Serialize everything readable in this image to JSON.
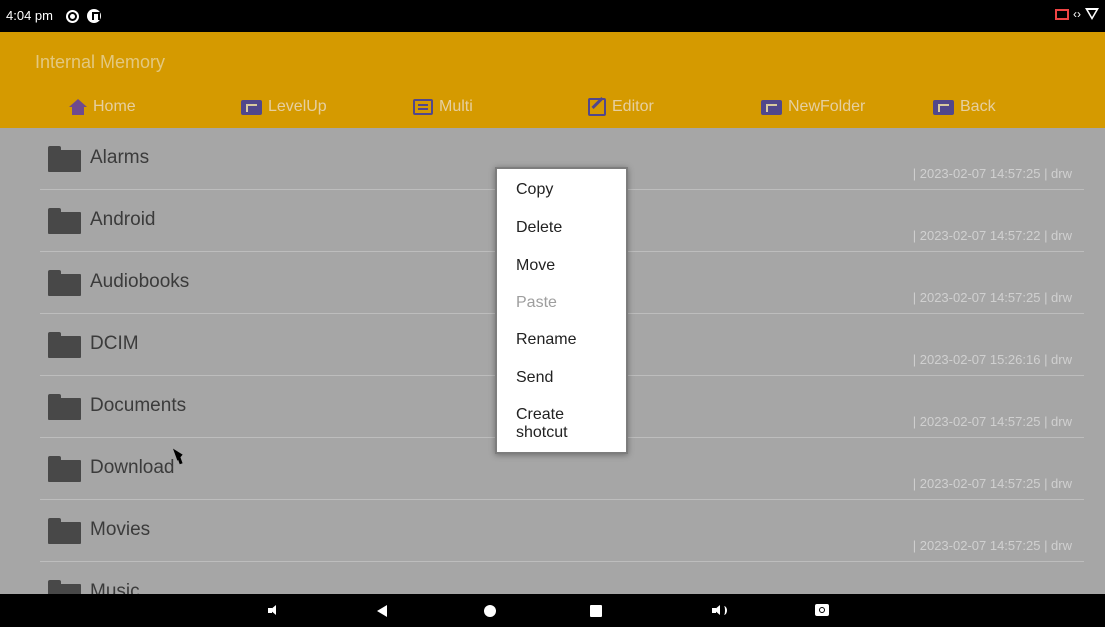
{
  "status_bar": {
    "time": "4:04 pm"
  },
  "app": {
    "title": "Internal Memory",
    "toolbar": [
      {
        "label": "Home",
        "icon": "home-icon"
      },
      {
        "label": "LevelUp",
        "icon": "folder-up-icon"
      },
      {
        "label": "Multi",
        "icon": "multi-select-icon"
      },
      {
        "label": "Editor",
        "icon": "edit-icon"
      },
      {
        "label": "NewFolder",
        "icon": "new-folder-icon"
      },
      {
        "label": "Back",
        "icon": "back-folder-icon"
      }
    ]
  },
  "files": [
    {
      "name": "Alarms",
      "meta": "| 2023-02-07 14:57:25 | drw"
    },
    {
      "name": "Android",
      "meta": "| 2023-02-07 14:57:22 | drw"
    },
    {
      "name": "Audiobooks",
      "meta": "| 2023-02-07 14:57:25 | drw"
    },
    {
      "name": "DCIM",
      "meta": "| 2023-02-07 15:26:16 | drw"
    },
    {
      "name": "Documents",
      "meta": "| 2023-02-07 14:57:25 | drw"
    },
    {
      "name": "Download",
      "meta": "| 2023-02-07 14:57:25 | drw"
    },
    {
      "name": "Movies",
      "meta": "| 2023-02-07 14:57:25 | drw"
    },
    {
      "name": "Music",
      "meta": ""
    }
  ],
  "context_menu": {
    "items": [
      {
        "label": "Copy",
        "enabled": true
      },
      {
        "label": "Delete",
        "enabled": true
      },
      {
        "label": "Move",
        "enabled": true
      },
      {
        "label": "Paste",
        "enabled": false
      },
      {
        "label": "Rename",
        "enabled": true
      },
      {
        "label": "Send",
        "enabled": true
      },
      {
        "label": "Create shotcut",
        "enabled": true
      }
    ]
  },
  "colors": {
    "header": "#d59a00",
    "list_background": "#a6a6a6",
    "toolbar_text": "#e6cfa0",
    "toolbar_icon": "#51478c"
  },
  "nav_bar": {
    "icons": [
      "volume-down-icon",
      "back-icon",
      "home-icon",
      "recents-icon",
      "volume-up-icon",
      "camera-icon"
    ]
  }
}
